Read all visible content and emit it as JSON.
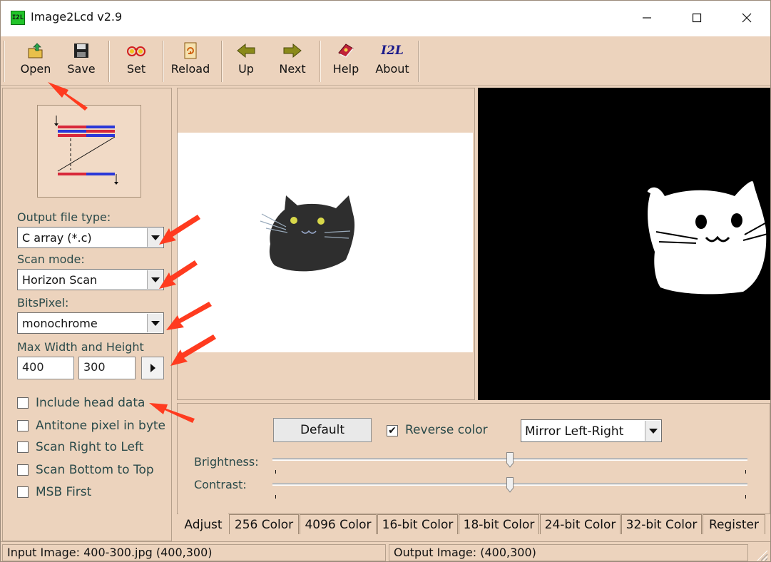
{
  "window": {
    "title": "Image2Lcd v2.9",
    "icon_text": "I2L"
  },
  "toolbar": {
    "open": "Open",
    "save": "Save",
    "set": "Set",
    "reload": "Reload",
    "up": "Up",
    "next": "Next",
    "help": "Help",
    "about": "About",
    "about_icon_text": "I2L"
  },
  "settings": {
    "output_file_type_label": "Output file type:",
    "output_file_type_value": "C array (*.c)",
    "scan_mode_label": "Scan mode:",
    "scan_mode_value": "Horizon Scan",
    "bits_pixel_label": "BitsPixel:",
    "bits_pixel_value": "monochrome",
    "max_size_label": "Max Width and Height",
    "max_width": "400",
    "max_height": "300",
    "checkboxes": [
      {
        "label": "Include head data",
        "checked": false
      },
      {
        "label": "Antitone pixel in byte",
        "checked": false
      },
      {
        "label": "Scan Right to Left",
        "checked": false
      },
      {
        "label": "Scan Bottom to Top",
        "checked": false
      },
      {
        "label": "MSB First",
        "checked": false
      }
    ]
  },
  "adjust": {
    "default_button": "Default",
    "reverse_color_label": "Reverse color",
    "reverse_color_checked": true,
    "mirror_value": "Mirror Left-Right",
    "brightness_label": "Brightness:",
    "contrast_label": "Contrast:",
    "brightness_level": 0.5,
    "contrast_level": 0.5
  },
  "tabs": [
    "Adjust",
    "256 Color",
    "4096 Color",
    "16-bit Color",
    "18-bit Color",
    "24-bit Color",
    "32-bit Color",
    "Register"
  ],
  "active_tab": "Adjust",
  "status": {
    "input": "Input Image: 400-300.jpg (400,300)",
    "output": "Output Image: (400,300)"
  },
  "colors": {
    "background": "#ecd3bd",
    "annotation_arrow": "#ff3b1f"
  }
}
